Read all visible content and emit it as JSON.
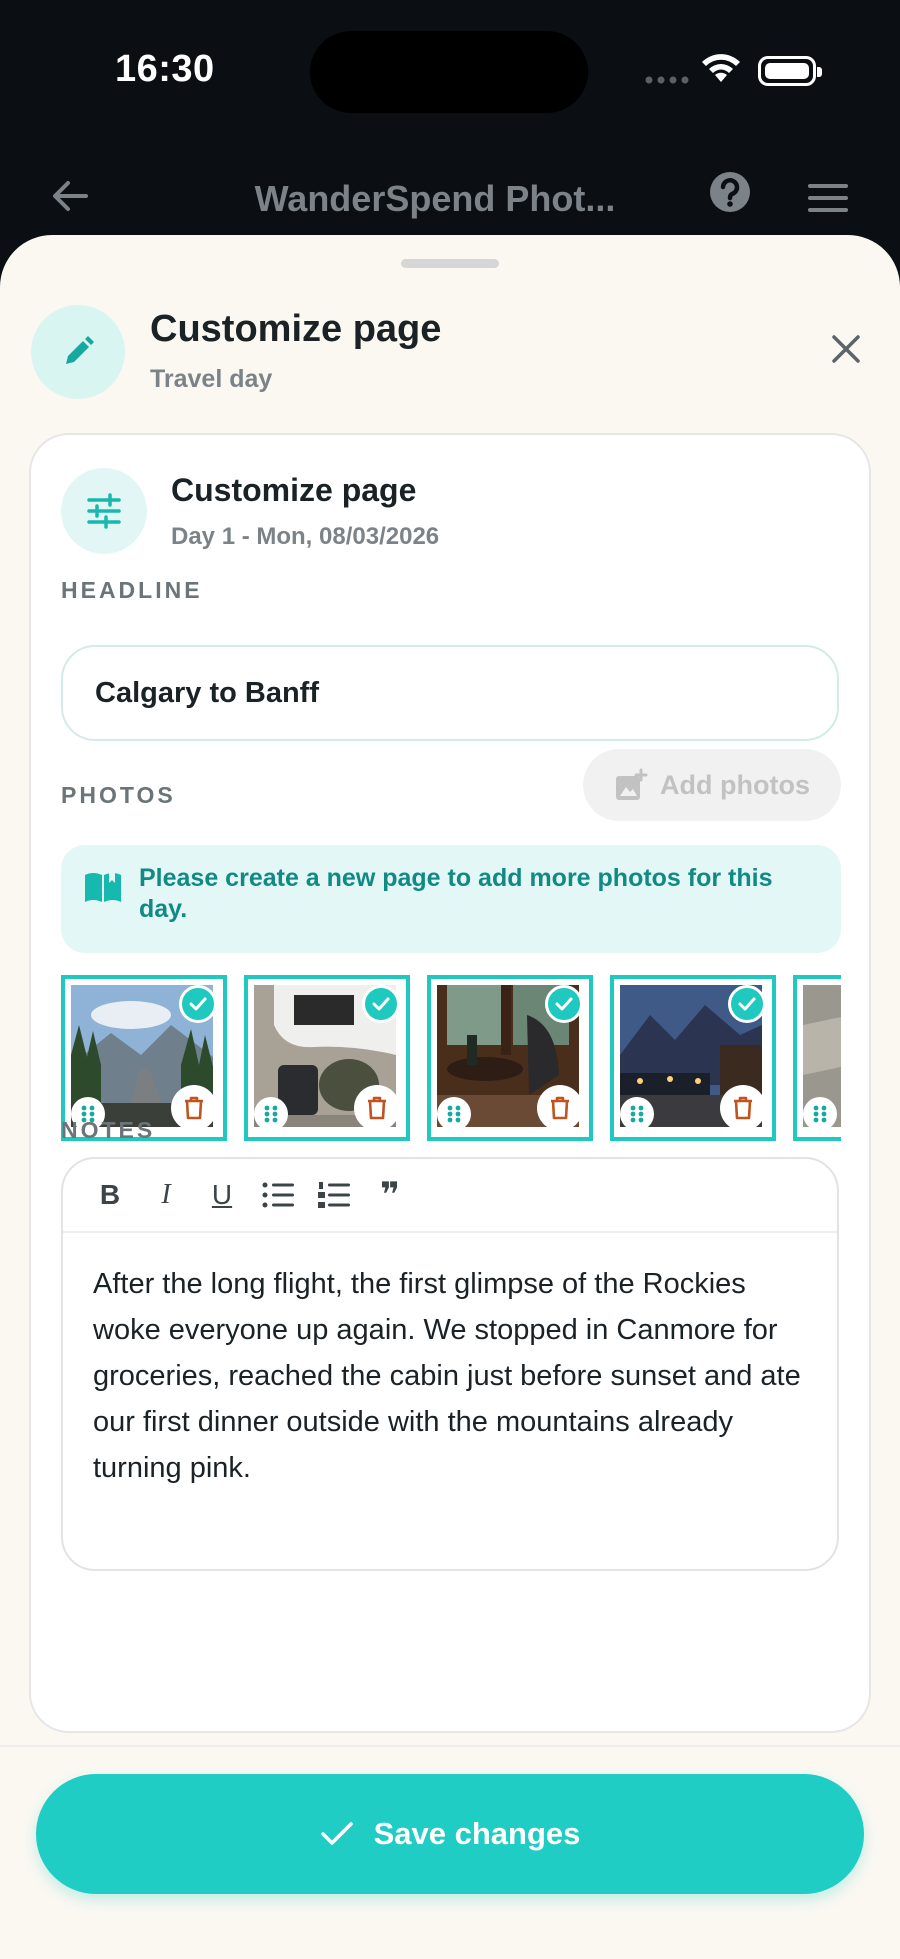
{
  "status_bar": {
    "time": "16:30"
  },
  "app_bar": {
    "title": "WanderSpend Phot..."
  },
  "sheet": {
    "title": "Customize page",
    "subtitle": "Travel day"
  },
  "card": {
    "title": "Customize page",
    "subtitle": "Day 1 - Mon, 08/03/2026",
    "headline_label": "HEADLINE",
    "headline_value": "Calgary to Banff",
    "photos_label": "PHOTOS",
    "add_photos_label": "Add photos",
    "info_message": "Please create a new page to add more photos for this day.",
    "notes_label": "NOTES",
    "notes_text": "After the long flight, the first glimpse of the Rockies woke everyone up again. We stopped in Canmore for groceries, reached the cabin just before sunset and ate our first dinner outside with the mountains already turning pink."
  },
  "toolbar": {
    "bold": "B",
    "italic": "I",
    "underline": "U",
    "quote": "❞"
  },
  "footer": {
    "save_label": "Save changes"
  },
  "colors": {
    "accent": "#1fcdc4",
    "accent_dark": "#118a84",
    "sheet_bg": "#fbf8f2",
    "trash": "#c0531e"
  }
}
